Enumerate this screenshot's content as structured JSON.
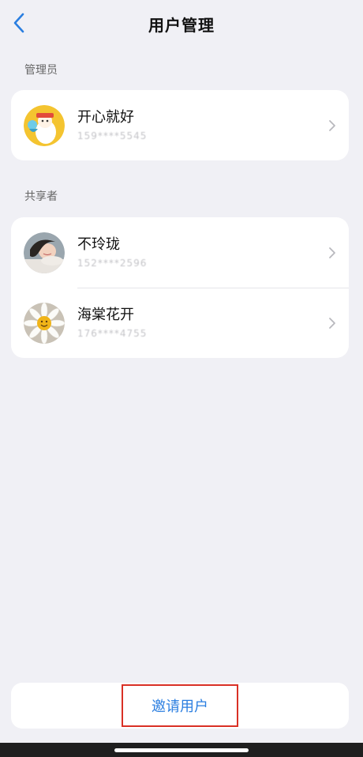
{
  "header": {
    "title": "用户管理"
  },
  "admin_section": {
    "label": "管理员",
    "users": [
      {
        "name": "开心就好",
        "phone": "159****5545"
      }
    ]
  },
  "shared_section": {
    "label": "共享者",
    "users": [
      {
        "name": "不玲珑",
        "phone": "152****2596"
      },
      {
        "name": "海棠花开",
        "phone": "176****4755"
      }
    ]
  },
  "footer": {
    "invite_label": "邀请用户"
  },
  "colors": {
    "accent": "#2a7ee0",
    "highlight_border": "#d93025",
    "background": "#f0f0f5"
  },
  "icons": {
    "back": "chevron-left-icon",
    "row_arrow": "chevron-right-icon"
  }
}
